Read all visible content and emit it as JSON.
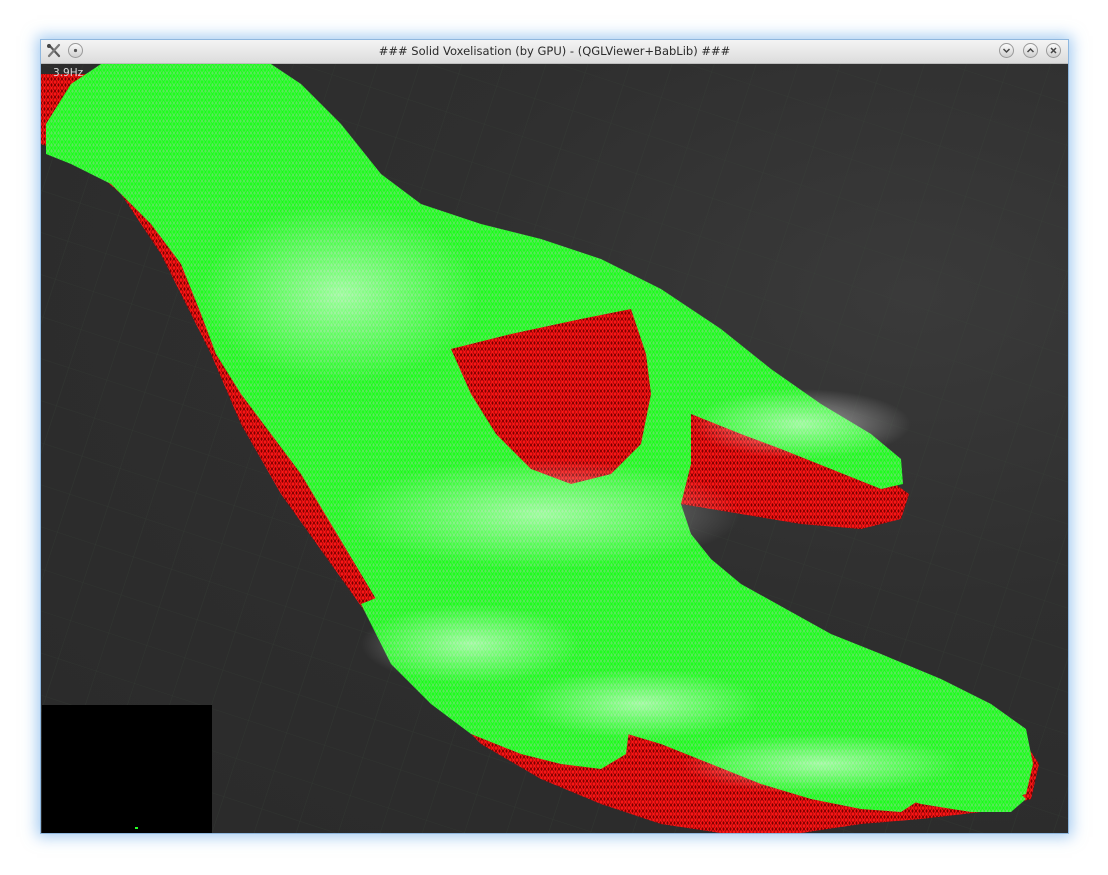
{
  "window": {
    "title": "### Solid Voxelisation (by GPU) - (QGLViewer+BabLib) ###",
    "icons": {
      "app": "app-tools-icon",
      "menu": "window-menu-icon",
      "minimize": "minimize-icon",
      "maximize": "maximize-icon",
      "close": "close-icon"
    }
  },
  "viewer": {
    "fps_label": "3.9Hz",
    "colors": {
      "inner_mesh": "#21ff21",
      "outer_mesh": "#ff1a1a",
      "background": "#2e2e2e",
      "minimap": "#000000"
    }
  }
}
